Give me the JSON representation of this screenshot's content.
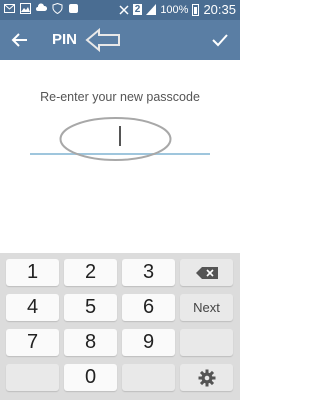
{
  "statusbar": {
    "sim": "2",
    "battery": "100%",
    "time": "20:35"
  },
  "toolbar": {
    "title": "PIN"
  },
  "content": {
    "prompt": "Re-enter your new passcode"
  },
  "keyboard": {
    "k1": "1",
    "k2": "2",
    "k3": "3",
    "k4": "4",
    "k5": "5",
    "k6": "6",
    "k7": "7",
    "k8": "8",
    "k9": "9",
    "k0": "0",
    "next": "Next"
  },
  "icons": {
    "back": "back-arrow-icon",
    "confirm": "checkmark-icon",
    "backspace": "backspace-icon",
    "settings": "gear-icon"
  },
  "colors": {
    "statusbar": "#4a6d92",
    "toolbar": "#5a7ea4",
    "underline": "#9fc6dd",
    "keyboard_bg": "#dcdcdc"
  }
}
